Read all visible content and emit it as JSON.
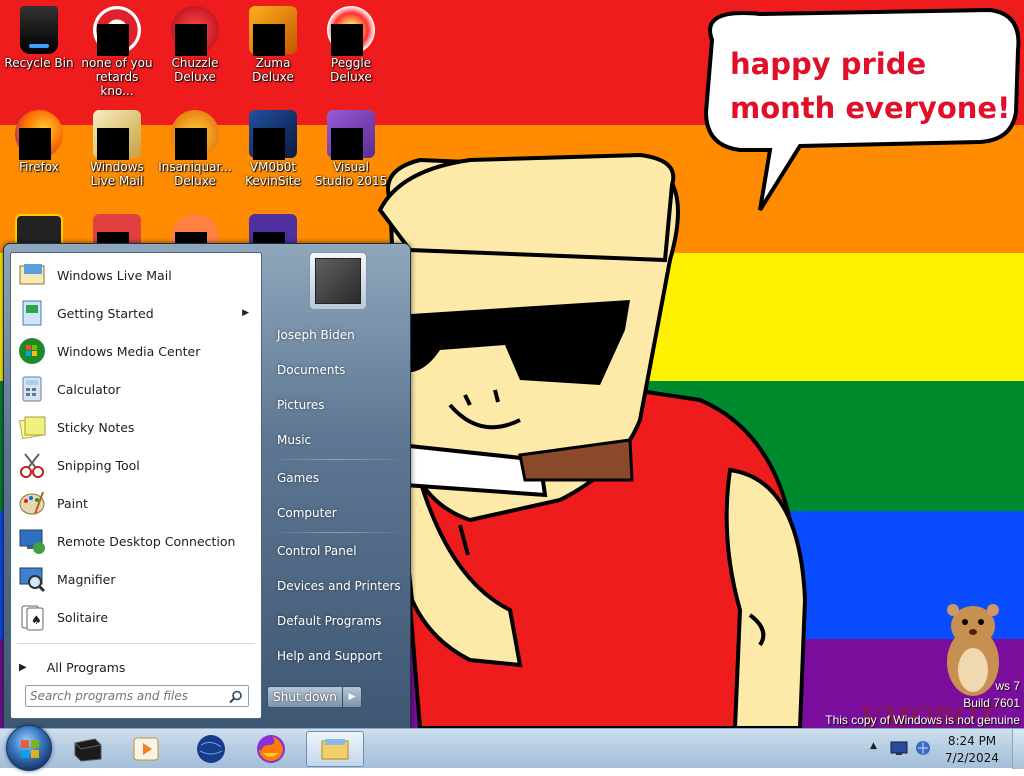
{
  "desktop": {
    "icons": [
      {
        "label": "Recycle Bin"
      },
      {
        "label": "none of you retards kno..."
      },
      {
        "label": "Chuzzle Deluxe"
      },
      {
        "label": "Zuma Deluxe"
      },
      {
        "label": "Peggle Deluxe"
      },
      {
        "label": "Firefox"
      },
      {
        "label": "Windows Live Mail"
      },
      {
        "label": "Insaniquar... Deluxe"
      },
      {
        "label": "VM0b0t KevinSite"
      },
      {
        "label": "Visual Studio 2015"
      }
    ],
    "speech_bubble": "happy pride month everyone!",
    "watermark": {
      "line1": "ws 7",
      "line2": "Build 7601",
      "line3": "This copy of Windows is not genuine",
      "logo": "VMOBOT"
    }
  },
  "start_menu": {
    "programs": [
      {
        "label": "Windows Live Mail",
        "icon": "mail-icon"
      },
      {
        "label": "Getting Started",
        "icon": "getting-started-icon",
        "submenu": true
      },
      {
        "label": "Windows Media Center",
        "icon": "media-center-icon"
      },
      {
        "label": "Calculator",
        "icon": "calculator-icon"
      },
      {
        "label": "Sticky Notes",
        "icon": "sticky-notes-icon"
      },
      {
        "label": "Snipping Tool",
        "icon": "snipping-tool-icon"
      },
      {
        "label": "Paint",
        "icon": "paint-icon"
      },
      {
        "label": "Remote Desktop Connection",
        "icon": "remote-desktop-icon"
      },
      {
        "label": "Magnifier",
        "icon": "magnifier-icon"
      },
      {
        "label": "Solitaire",
        "icon": "solitaire-icon"
      }
    ],
    "all_programs": "All Programs",
    "search_placeholder": "Search programs and files",
    "right_links": [
      {
        "label": "Joseph Biden"
      },
      {
        "label": "Documents"
      },
      {
        "label": "Pictures"
      },
      {
        "label": "Music"
      },
      {
        "label": "Games"
      },
      {
        "label": "Computer"
      },
      {
        "label": "Control Panel"
      },
      {
        "label": "Devices and Printers"
      },
      {
        "label": "Default Programs"
      },
      {
        "label": "Help and Support"
      }
    ],
    "shutdown": "Shut down"
  },
  "taskbar": {
    "clock_time": "8:24 PM",
    "clock_date": "7/2/2024"
  },
  "colors": {
    "red": "#ee1c1c",
    "orange": "#ff8c00",
    "yellow": "#fff200",
    "green": "#008a2e",
    "blue": "#0a4cff",
    "purple": "#7b0d9c"
  }
}
